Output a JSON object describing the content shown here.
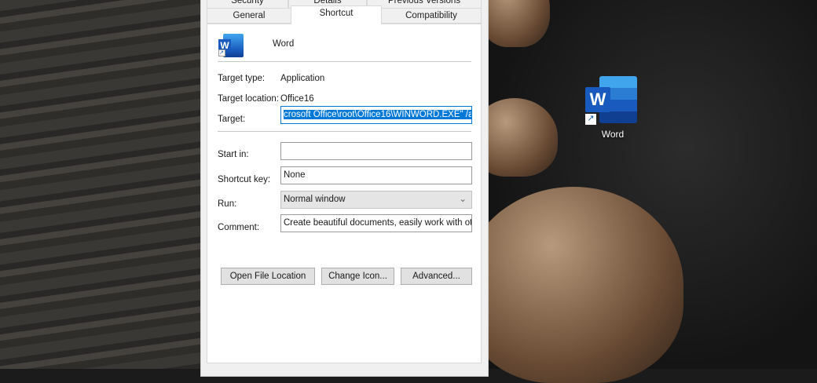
{
  "tabs_top": [
    "Security",
    "Details",
    "Previous Versions"
  ],
  "tabs_bottom": [
    "General",
    "Shortcut",
    "Compatibility"
  ],
  "selected_tab": "Shortcut",
  "app_name": "Word",
  "fields": {
    "target_type_label": "Target type:",
    "target_type": "Application",
    "target_location_label": "Target location:",
    "target_location": "Office16",
    "target_label": "Target:",
    "target": "crosoft Office\\root\\Office16\\WINWORD.EXE\" /a",
    "start_in_label": "Start in:",
    "start_in": "",
    "shortcut_key_label": "Shortcut key:",
    "shortcut_key": "None",
    "run_label": "Run:",
    "run": "Normal window",
    "comment_label": "Comment:",
    "comment": "Create beautiful documents, easily work with others"
  },
  "buttons": {
    "open_location": "Open File Location",
    "change_icon": "Change Icon...",
    "advanced": "Advanced..."
  },
  "desktop_icon": {
    "label": "Word",
    "icon_letter": "W"
  },
  "colors": {
    "word_blue": "#185abd",
    "selection": "#0078d7"
  }
}
